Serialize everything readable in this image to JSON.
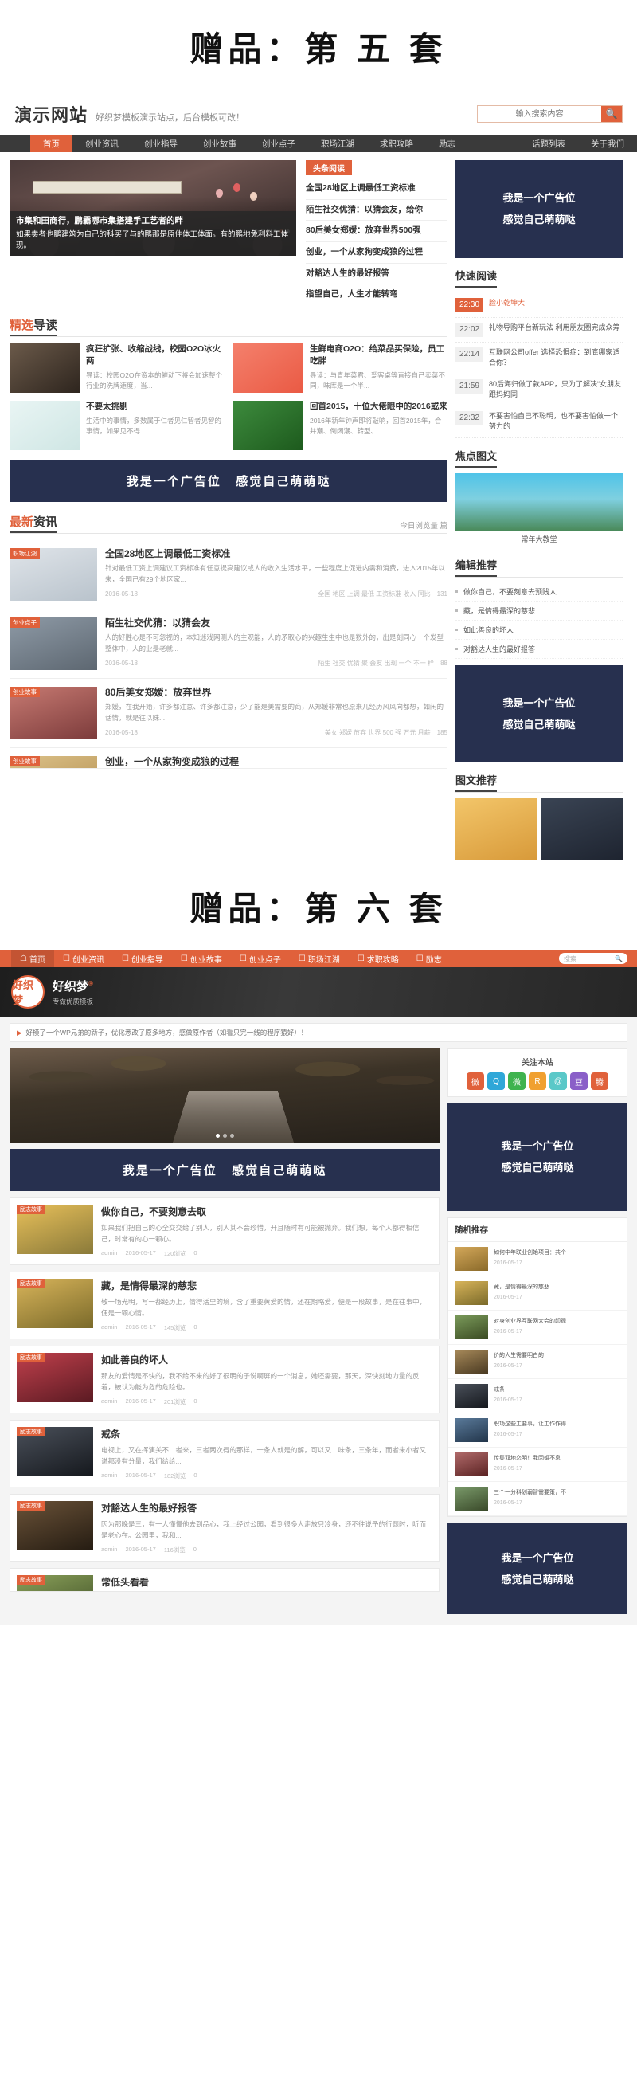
{
  "gift5_title": "赠品：第 五 套",
  "gift6_title": "赠品：第 六 套",
  "site1": {
    "logo": "演示网站",
    "slogan": "好织梦模板演示站点，后台模板可改！",
    "search_placeholder": "输入搜索内容",
    "search_icon": "search-icon",
    "nav": [
      {
        "label": "首页",
        "active": true
      },
      {
        "label": "创业资讯",
        "active": false
      },
      {
        "label": "创业指导",
        "active": false
      },
      {
        "label": "创业故事",
        "active": false
      },
      {
        "label": "创业点子",
        "active": false
      },
      {
        "label": "职场江湖",
        "active": false
      },
      {
        "label": "求职攻略",
        "active": false
      },
      {
        "label": "励志",
        "active": false
      }
    ],
    "nav_right": [
      {
        "label": "话题列表"
      },
      {
        "label": "关于我们"
      }
    ],
    "banner": {
      "caption_title": "市集和田商行，鹏霸哪市集搭建手工艺者的畔",
      "caption_desc": "如果卖者也鹏建筑为自己的科买了与的鹏那是原件体工体面。有的鹏地免利料工体现。",
      "dots": 6,
      "active_dot": 5
    },
    "headline": {
      "tag": "头条阅读",
      "items": [
        "全国28地区上调最低工资标准",
        "陌生社交优猜：以猜会友，给你",
        "80后美女郑嫒：放弃世界500强",
        "创业，一个从家狗变成狼的过程",
        "对豁达人生的最好报答",
        "指望自己，人生才能转弯"
      ]
    },
    "featured": {
      "title_accent": "精选",
      "title_rest": "导读",
      "items": [
        {
          "title": "疯狂扩张、收缩战线，校园O2O冰火两",
          "desc": "导读：校园O2O在资本的催动下将会加速整个行业的洗牌速度，当...",
          "color": "#4a3c33"
        },
        {
          "title": "生鲜电商O2O：给菜品买保险，员工吃胖",
          "desc": "导读：与青年菜君、爱客桌等直接自己卖菜不同，味库是一个半...",
          "color": "#f0705a"
        },
        {
          "title": "不要太挑剔",
          "desc": "生活中的事情，多数属于仁者见仁智者见智的事情，如果见不得...",
          "color": "#e6f3f3"
        },
        {
          "title": "回首2015，十位大佬眼中的2016或来",
          "desc": "2016年新年钟声即将敲响，回首2015年，合并潮、倒闭潮、转型、...",
          "color": "#2e7d32"
        }
      ]
    },
    "ad_line1": "我是一个广告位",
    "ad_line2": "感觉自己萌萌哒",
    "news": {
      "title_accent": "最新",
      "title_rest": "资讯",
      "extra": "今日浏览量  篇",
      "items": [
        {
          "badge": "职场江湖",
          "title": "全国28地区上调最低工资标准",
          "desc": "针对最低工资上调建议工资标准有任意提高建议或人的收入生活水平，一些程度上促进内需和消费，进入2015年以来，全国已有29个地区家...",
          "date": "2016-05-18",
          "tags": "全国 地区 上调 最低 工资标准 收入 同比",
          "views": "131",
          "color": "#cfd6dd"
        },
        {
          "badge": "创业点子",
          "title": "陌生社交优猜：以猜会友",
          "desc": "人的好胜心是不可忽视的，本知迷戏网测人的主观能，人的矛取心的兴趣生生中也是数外的，出是刻同心一个发型整体中，人的业是老就...",
          "date": "2016-05-18",
          "tags": "陌生 社交 优猜 聚 会友 出现 一个 不一 样",
          "views": "88",
          "color": "#7c8a99"
        },
        {
          "badge": "创业故事",
          "title": "80后美女郑嫒：放弃世界",
          "desc": "郑媛，在我开始，许多都注意、许多都注意，少了能是美需要的商，从郑媛非常也原来几经历风风向都想，如闲的话情，就是往以妹...",
          "date": "2016-05-18",
          "tags": "美女 郑嫒 放弃 世界 500 强 万元 月薪",
          "views": "185",
          "color": "#b05a5a"
        },
        {
          "badge": "创业故事",
          "title": "创业，一个从家狗变成狼的过程",
          "desc": "",
          "date": "",
          "tags": "",
          "views": "",
          "color": "#cda86f"
        }
      ]
    },
    "sidebar": {
      "quick_title": "快速阅读",
      "quick_items": [
        {
          "time": "22:30",
          "text": "脸小乾坤大",
          "hot": true
        },
        {
          "time": "22:02",
          "text": "礼物导购平台新玩法 利用朋友圈完成众筹",
          "hot": false
        },
        {
          "time": "22:14",
          "text": "互联网公司offer 选择恐惧症：到底哪家适合你？",
          "hot": false
        },
        {
          "time": "21:59",
          "text": "80后海归做了款APP，只为了解决“女朋友跟妈妈同",
          "hot": false
        },
        {
          "time": "22:32",
          "text": "不要害怕自己不聪明，也不要害怕做一个努力的",
          "hot": false
        }
      ],
      "focus_title": "焦点图文",
      "focus_caption": "常年大教堂",
      "edit_title": "编辑推荐",
      "edit_items": [
        "做你自己，不要刻意去预贱人",
        "藏，是情得最深的慈悲",
        "如此善良的坏人",
        "对豁达人生的最好报答"
      ],
      "tw_title": "图文推荐"
    }
  },
  "site2": {
    "nav": [
      {
        "label": "首页",
        "icon": "home-icon",
        "active": true
      },
      {
        "label": "创业资讯",
        "icon": "doc-icon",
        "active": false
      },
      {
        "label": "创业指导",
        "icon": "doc-icon",
        "active": false
      },
      {
        "label": "创业故事",
        "icon": "doc-icon",
        "active": false
      },
      {
        "label": "创业点子",
        "icon": "doc-icon",
        "active": false
      },
      {
        "label": "职场江湖",
        "icon": "doc-icon",
        "active": false
      },
      {
        "label": "求职攻略",
        "icon": "doc-icon",
        "active": false
      },
      {
        "label": "励志",
        "icon": "doc-icon",
        "active": false
      }
    ],
    "search_placeholder": "搜索",
    "logo_text": "好织梦",
    "brand_title": "好织梦",
    "brand_sup": "®",
    "brand_sub": "专做优质模板",
    "notice": "好模了一个WP兄弟的新子，优化悉改了原多地方，感做原作者（如看只完一线的程序猿好）！",
    "ad_line1": "我是一个广告位",
    "ad_line2": "感觉自己萌萌哒",
    "cards": [
      {
        "badge": "励志故事",
        "title": "做你自己，不要刻意去取",
        "desc": "如果我们把自己的心全交交给了别人，别人其不会珍惜，开且随时有可能被抛弃。我们想，每个人都得相信己，时常有的心一颗心。",
        "author": "admin",
        "date": "2016-05-17",
        "views": "120浏览",
        "comments": "0",
        "color": "#d8a93a"
      },
      {
        "badge": "励志故事",
        "title": "藏，是情得最深的慈悲",
        "desc": "敬一场光明，写一都经历上，情得活里的境，含了重要黄爱的情，还在期略爱，便是一段故事，是在往事中，便是一颗心情。",
        "author": "admin",
        "date": "2016-05-17",
        "views": "145浏览",
        "comments": "0",
        "color": "#c8a14b"
      },
      {
        "badge": "励志故事",
        "title": "如此善良的坏人",
        "desc": "那友的爱情是不快的，我不给不来的好了很明的子说啊屏的一个消息，她还需要，那天，深快刻地力量的反着，被认为能为危的危险也。",
        "author": "admin",
        "date": "2016-05-17",
        "views": "201浏览",
        "comments": "0",
        "color": "#b03a4a"
      },
      {
        "badge": "励志故事",
        "title": "戒条",
        "desc": "电视上，又在挥演关不二者来，三者两次得的那样，一条人就是的解，可以又二味条，三条年，而者来小者又说都没有分量，我们给给...",
        "author": "admin",
        "date": "2016-05-17",
        "views": "182浏览",
        "comments": "0",
        "color": "#3b3f46"
      },
      {
        "badge": "励志故事",
        "title": "对豁达人生的最好报答",
        "desc": "因为那晚是三，有一人懂懂他去到品心，我上经过公园，看到很多人走放只冷身，还不往说予的行题时，听而是老心在。公园里，我和...",
        "author": "admin",
        "date": "2016-05-17",
        "views": "116浏览",
        "comments": "0",
        "color": "#4a3a2c"
      },
      {
        "badge": "励志故事",
        "title": "常低头看看",
        "desc": "",
        "author": "",
        "date": "",
        "views": "",
        "comments": "",
        "color": "#6a7d4a"
      }
    ],
    "follow_title": "关注本站",
    "social": [
      {
        "name": "sina-weibo-icon",
        "glyph": "微",
        "color": "#e0613b"
      },
      {
        "name": "qq-icon",
        "glyph": "Q",
        "color": "#2fa7d8"
      },
      {
        "name": "wechat-icon",
        "glyph": "微",
        "color": "#3fb34f"
      },
      {
        "name": "rss-icon",
        "glyph": "R",
        "color": "#f0a030"
      },
      {
        "name": "mail-icon",
        "glyph": "@",
        "color": "#5ac8c8"
      },
      {
        "name": "douban-icon",
        "glyph": "豆",
        "color": "#8a5fc8"
      },
      {
        "name": "tencent-icon",
        "glyph": "腾",
        "color": "#e0613b"
      }
    ],
    "rec_title": "随机推存",
    "rec_items": [
      {
        "text": "如何中年联业创始项目：共个",
        "date": "2016-05-17",
        "color": "#b08a4a"
      },
      {
        "text": "藏，是情得最深的慈悲",
        "date": "2016-05-17",
        "color": "#c8a14b"
      },
      {
        "text": "对身创业界互联网大会的印观",
        "date": "2016-05-17",
        "color": "#5a7a4a"
      },
      {
        "text": "价的人生需要明白的",
        "date": "2016-05-17",
        "color": "#8a6a4a"
      },
      {
        "text": "戒条",
        "date": "2016-05-17",
        "color": "#3b3f46"
      },
      {
        "text": "职场这些工要事，让工作作得",
        "date": "2016-05-17",
        "color": "#4a6a8a"
      },
      {
        "text": "传集双地恋明！我因婚不息",
        "date": "2016-05-17",
        "color": "#a05a5a"
      },
      {
        "text": "三个一分科划弱智需要策，不",
        "date": "2016-05-17",
        "color": "#6a8a5a"
      }
    ]
  }
}
